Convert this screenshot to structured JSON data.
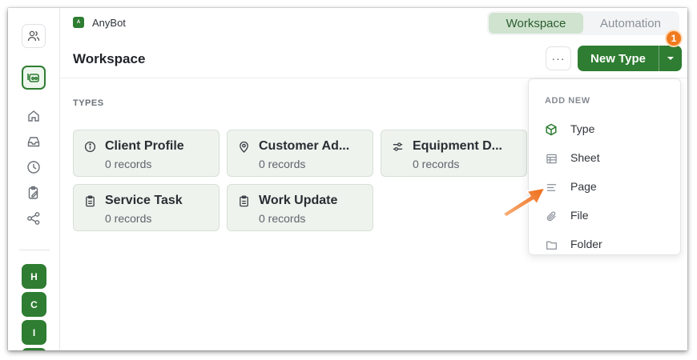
{
  "app": {
    "name": "AnyBot",
    "logo_letter": "A"
  },
  "top_tabs": [
    {
      "label": "Workspace",
      "active": true
    },
    {
      "label": "Automation",
      "active": false
    }
  ],
  "header": {
    "title": "Workspace",
    "more_label": "···",
    "new_type_label": "New Type",
    "step_badge": "1"
  },
  "sidebar": {
    "icons": [
      "users-icon",
      "bot-icon",
      "home-icon",
      "inbox-icon",
      "clock-icon",
      "clipboard-edit-icon",
      "share-icon"
    ],
    "workspaces": [
      "H",
      "C",
      "I"
    ]
  },
  "types": {
    "section_label": "TYPES",
    "cards": [
      {
        "title": "Client Profile",
        "subtitle": "0 records",
        "icon": "info-icon"
      },
      {
        "title": "Customer Ad...",
        "subtitle": "0 records",
        "icon": "map-pin-icon"
      },
      {
        "title": "Equipment D...",
        "subtitle": "0 records",
        "icon": "sliders-icon"
      },
      {
        "title": "Service Task",
        "subtitle": "0 records",
        "icon": "clipboard-icon"
      },
      {
        "title": "Work Update",
        "subtitle": "0 records",
        "icon": "clipboard-icon"
      }
    ]
  },
  "add_new_menu": {
    "heading": "ADD NEW",
    "items": [
      {
        "label": "Type",
        "icon": "cube-icon"
      },
      {
        "label": "Sheet",
        "icon": "table-icon"
      },
      {
        "label": "Page",
        "icon": "text-lines-icon"
      },
      {
        "label": "File",
        "icon": "paperclip-icon"
      },
      {
        "label": "Folder",
        "icon": "folder-icon"
      }
    ]
  },
  "colors": {
    "brand": "#2e7d32",
    "active_tab_bg": "#cfe3cf",
    "card_bg": "#eef3ee",
    "badge": "#f07a1e"
  }
}
